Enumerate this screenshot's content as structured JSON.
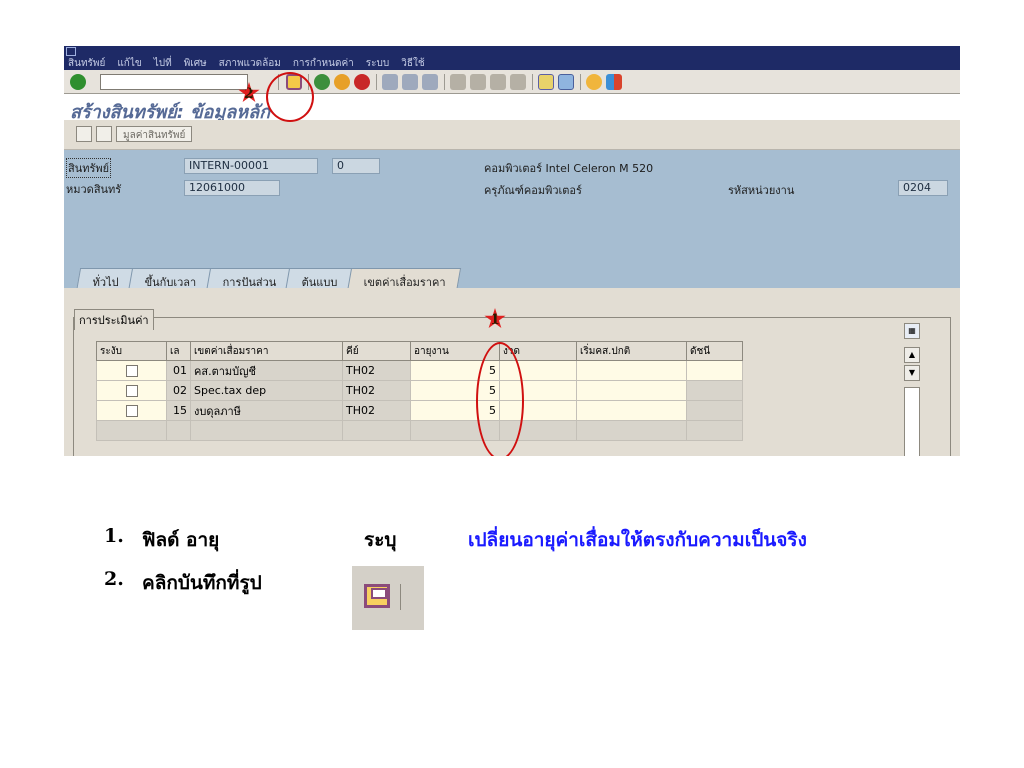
{
  "menu": [
    "สินทรัพย์",
    "แก้ไข",
    "ไปที่",
    "พิเศษ",
    "สภาพแวดล้อม",
    "การกำหนดค่า",
    "ระบบ",
    "วิธีใช้"
  ],
  "title": "สร้างสินทรัพย์: ข้อมูลหลัก",
  "subtoolbar": {
    "asset_values_label": "มูลค่าสินทรัพย์"
  },
  "header": {
    "asset_label": "สินทรัพย์",
    "asset_value": "INTERN-00001",
    "sub_number": "0",
    "description": "คอมพิวเตอร์ Intel Celeron M 520",
    "class_label": "หมวดสินทรั",
    "class_value": "12061000",
    "class_description": "ครุภัณฑ์คอมพิวเตอร์",
    "unit_label": "รหัสหน่วยงาน",
    "unit_value": "0204"
  },
  "tabs": [
    "ทั่วไป",
    "ขึ้นกับเวลา",
    "การปันส่วน",
    "ต้นแบบ",
    "เขตค่าเสื่อมราคา"
  ],
  "active_tab": 4,
  "group_label": "การประเมินค่า",
  "table": {
    "headers": [
      "ระงับ",
      "เล",
      "เขตค่าเสื่อมราคา",
      "คีย์",
      "อายุงาน",
      "งวด",
      "เริ่มคส.ปกติ",
      "ดัชนี"
    ],
    "rows": [
      {
        "no": "01",
        "area": "คส.ตามบัญชี",
        "key": "TH02",
        "life": "5"
      },
      {
        "no": "02",
        "area": "Spec.tax dep",
        "key": "TH02",
        "life": "5"
      },
      {
        "no": "15",
        "area": "งบดุลภาษี",
        "key": "TH02",
        "life": "5"
      }
    ]
  },
  "markers": {
    "one": "1",
    "two": "2"
  },
  "instructions": [
    {
      "num": "1.",
      "text": "ฟิลด์ อายุ",
      "middle": "ระบุ",
      "note": "เปลี่ยนอายุค่าเสื่อมให้ตรงกับความเป็นจริง"
    },
    {
      "num": "2.",
      "text": "คลิกบันทึกที่รูป"
    }
  ],
  "colors": {
    "note_blue": "#1a1aff",
    "annotation_red": "#d01010"
  }
}
